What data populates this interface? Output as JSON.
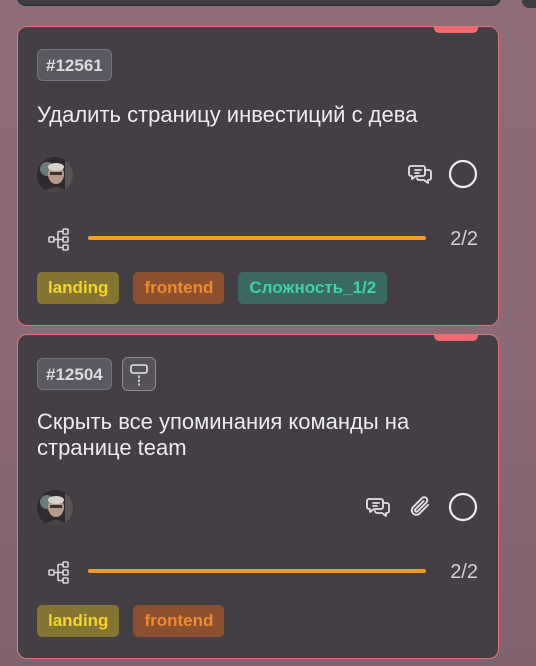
{
  "colors": {
    "card_bg": "#433f45",
    "card_border": "#e6727a",
    "priority_flag": "#f06b6f",
    "progress_fill": "#f59a26",
    "tag_landing_text": "#f5d52a",
    "tag_frontend_text": "#f08a2e",
    "tag_complexity_text": "#3fd2aa"
  },
  "cards": [
    {
      "id": "#12561",
      "title": "Удалить страницу инвестиций с дева",
      "assignee_avatar": "avatar",
      "icons": [
        "comments-icon",
        "status-circle-icon"
      ],
      "progress": {
        "done": 2,
        "total": 2,
        "fraction": 1.0,
        "label": "2/2"
      },
      "tags": [
        "landing",
        "frontend",
        "Сложность_1/2"
      ]
    },
    {
      "id": "#12504",
      "title": "Скрыть все упоминания команды на странице team",
      "type_icon": "task-type-icon",
      "assignee_avatar": "avatar",
      "icons": [
        "comments-icon",
        "paperclip-icon",
        "status-circle-icon"
      ],
      "progress": {
        "done": 2,
        "total": 2,
        "fraction": 1.0,
        "label": "2/2"
      },
      "tags": [
        "landing",
        "frontend"
      ]
    }
  ]
}
